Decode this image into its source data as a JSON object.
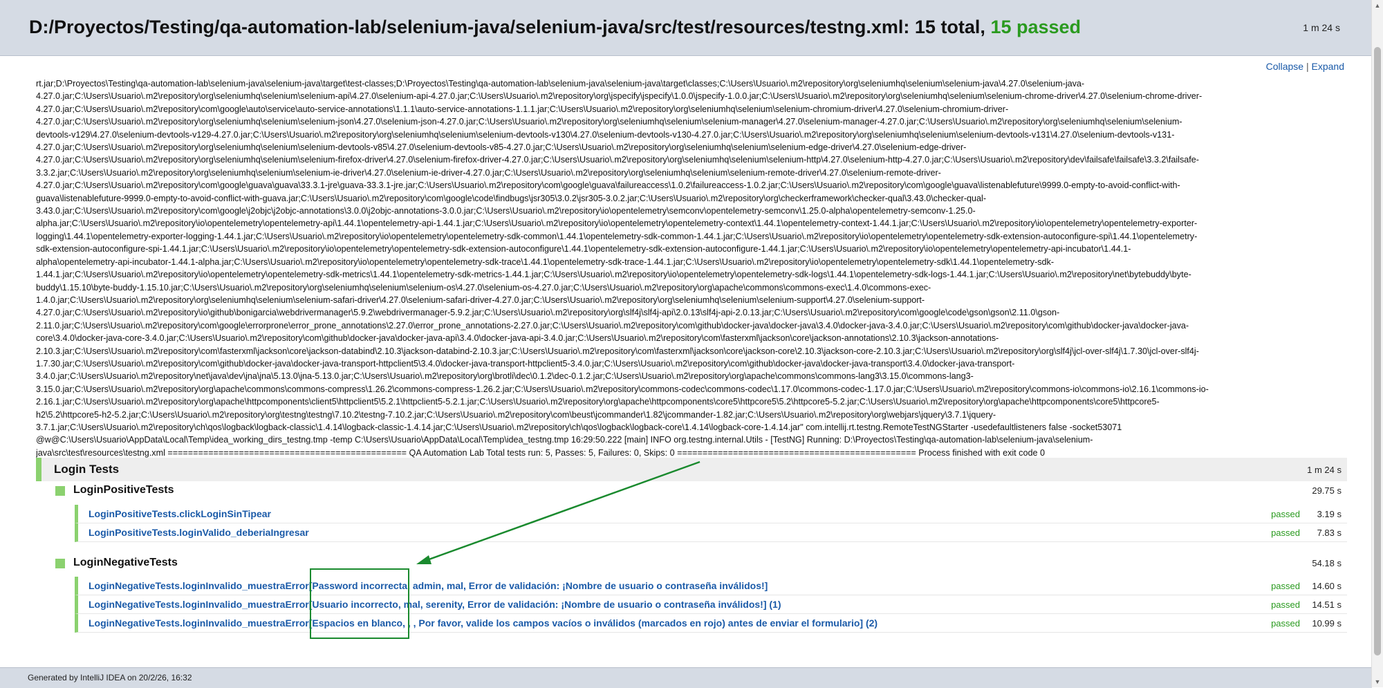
{
  "header": {
    "path": "D:/Proyectos/Testing/qa-automation-lab/selenium-java/selenium-java/src/test/resources/testng.xml:",
    "total": "15 total,",
    "passed": "15 passed",
    "time": "1 m 24 s"
  },
  "links": {
    "collapse": "Collapse",
    "separator": "|",
    "expand": "Expand"
  },
  "log_lines": [
    "rt.jar;D:\\Proyectos\\Testing\\qa-automation-lab\\selenium-java\\selenium-java\\target\\test-classes;D:\\Proyectos\\Testing\\qa-automation-lab\\selenium-java\\selenium-java\\target\\classes;C:\\Users\\Usuario\\.m2\\repository\\org\\seleniumhq\\selenium\\selenium-java\\4.27.0\\selenium-java-",
    "4.27.0.jar;C:\\Users\\Usuario\\.m2\\repository\\org\\seleniumhq\\selenium\\selenium-api\\4.27.0\\selenium-api-4.27.0.jar;C:\\Users\\Usuario\\.m2\\repository\\org\\jspecify\\jspecify\\1.0.0\\jspecify-1.0.0.jar;C:\\Users\\Usuario\\.m2\\repository\\org\\seleniumhq\\selenium\\selenium-chrome-driver\\4.27.0\\selenium-chrome-driver-",
    "4.27.0.jar;C:\\Users\\Usuario\\.m2\\repository\\com\\google\\auto\\service\\auto-service-annotations\\1.1.1\\auto-service-annotations-1.1.1.jar;C:\\Users\\Usuario\\.m2\\repository\\org\\seleniumhq\\selenium\\selenium-chromium-driver\\4.27.0\\selenium-chromium-driver-",
    "4.27.0.jar;C:\\Users\\Usuario\\.m2\\repository\\org\\seleniumhq\\selenium\\selenium-json\\4.27.0\\selenium-json-4.27.0.jar;C:\\Users\\Usuario\\.m2\\repository\\org\\seleniumhq\\selenium\\selenium-manager\\4.27.0\\selenium-manager-4.27.0.jar;C:\\Users\\Usuario\\.m2\\repository\\org\\seleniumhq\\selenium\\selenium-",
    "devtools-v129\\4.27.0\\selenium-devtools-v129-4.27.0.jar;C:\\Users\\Usuario\\.m2\\repository\\org\\seleniumhq\\selenium\\selenium-devtools-v130\\4.27.0\\selenium-devtools-v130-4.27.0.jar;C:\\Users\\Usuario\\.m2\\repository\\org\\seleniumhq\\selenium\\selenium-devtools-v131\\4.27.0\\selenium-devtools-v131-",
    "4.27.0.jar;C:\\Users\\Usuario\\.m2\\repository\\org\\seleniumhq\\selenium\\selenium-devtools-v85\\4.27.0\\selenium-devtools-v85-4.27.0.jar;C:\\Users\\Usuario\\.m2\\repository\\org\\seleniumhq\\selenium\\selenium-edge-driver\\4.27.0\\selenium-edge-driver-",
    "4.27.0.jar;C:\\Users\\Usuario\\.m2\\repository\\org\\seleniumhq\\selenium\\selenium-firefox-driver\\4.27.0\\selenium-firefox-driver-4.27.0.jar;C:\\Users\\Usuario\\.m2\\repository\\org\\seleniumhq\\selenium\\selenium-http\\4.27.0\\selenium-http-4.27.0.jar;C:\\Users\\Usuario\\.m2\\repository\\dev\\failsafe\\failsafe\\3.3.2\\failsafe-",
    "3.3.2.jar;C:\\Users\\Usuario\\.m2\\repository\\org\\seleniumhq\\selenium\\selenium-ie-driver\\4.27.0\\selenium-ie-driver-4.27.0.jar;C:\\Users\\Usuario\\.m2\\repository\\org\\seleniumhq\\selenium\\selenium-remote-driver\\4.27.0\\selenium-remote-driver-",
    "4.27.0.jar;C:\\Users\\Usuario\\.m2\\repository\\com\\google\\guava\\guava\\33.3.1-jre\\guava-33.3.1-jre.jar;C:\\Users\\Usuario\\.m2\\repository\\com\\google\\guava\\failureaccess\\1.0.2\\failureaccess-1.0.2.jar;C:\\Users\\Usuario\\.m2\\repository\\com\\google\\guava\\listenablefuture\\9999.0-empty-to-avoid-conflict-with-",
    "guava\\listenablefuture-9999.0-empty-to-avoid-conflict-with-guava.jar;C:\\Users\\Usuario\\.m2\\repository\\com\\google\\code\\findbugs\\jsr305\\3.0.2\\jsr305-3.0.2.jar;C:\\Users\\Usuario\\.m2\\repository\\org\\checkerframework\\checker-qual\\3.43.0\\checker-qual-",
    "3.43.0.jar;C:\\Users\\Usuario\\.m2\\repository\\com\\google\\j2objc\\j2objc-annotations\\3.0.0\\j2objc-annotations-3.0.0.jar;C:\\Users\\Usuario\\.m2\\repository\\io\\opentelemetry\\semconv\\opentelemetry-semconv\\1.25.0-alpha\\opentelemetry-semconv-1.25.0-",
    "alpha.jar;C:\\Users\\Usuario\\.m2\\repository\\io\\opentelemetry\\opentelemetry-api\\1.44.1\\opentelemetry-api-1.44.1.jar;C:\\Users\\Usuario\\.m2\\repository\\io\\opentelemetry\\opentelemetry-context\\1.44.1\\opentelemetry-context-1.44.1.jar;C:\\Users\\Usuario\\.m2\\repository\\io\\opentelemetry\\opentelemetry-exporter-",
    "logging\\1.44.1\\opentelemetry-exporter-logging-1.44.1.jar;C:\\Users\\Usuario\\.m2\\repository\\io\\opentelemetry\\opentelemetry-sdk-common\\1.44.1\\opentelemetry-sdk-common-1.44.1.jar;C:\\Users\\Usuario\\.m2\\repository\\io\\opentelemetry\\opentelemetry-sdk-extension-autoconfigure-spi\\1.44.1\\opentelemetry-",
    "sdk-extension-autoconfigure-spi-1.44.1.jar;C:\\Users\\Usuario\\.m2\\repository\\io\\opentelemetry\\opentelemetry-sdk-extension-autoconfigure\\1.44.1\\opentelemetry-sdk-extension-autoconfigure-1.44.1.jar;C:\\Users\\Usuario\\.m2\\repository\\io\\opentelemetry\\opentelemetry-api-incubator\\1.44.1-",
    "alpha\\opentelemetry-api-incubator-1.44.1-alpha.jar;C:\\Users\\Usuario\\.m2\\repository\\io\\opentelemetry\\opentelemetry-sdk-trace\\1.44.1\\opentelemetry-sdk-trace-1.44.1.jar;C:\\Users\\Usuario\\.m2\\repository\\io\\opentelemetry\\opentelemetry-sdk\\1.44.1\\opentelemetry-sdk-",
    "1.44.1.jar;C:\\Users\\Usuario\\.m2\\repository\\io\\opentelemetry\\opentelemetry-sdk-metrics\\1.44.1\\opentelemetry-sdk-metrics-1.44.1.jar;C:\\Users\\Usuario\\.m2\\repository\\io\\opentelemetry\\opentelemetry-sdk-logs\\1.44.1\\opentelemetry-sdk-logs-1.44.1.jar;C:\\Users\\Usuario\\.m2\\repository\\net\\bytebuddy\\byte-",
    "buddy\\1.15.10\\byte-buddy-1.15.10.jar;C:\\Users\\Usuario\\.m2\\repository\\org\\seleniumhq\\selenium\\selenium-os\\4.27.0\\selenium-os-4.27.0.jar;C:\\Users\\Usuario\\.m2\\repository\\org\\apache\\commons\\commons-exec\\1.4.0\\commons-exec-",
    "1.4.0.jar;C:\\Users\\Usuario\\.m2\\repository\\org\\seleniumhq\\selenium\\selenium-safari-driver\\4.27.0\\selenium-safari-driver-4.27.0.jar;C:\\Users\\Usuario\\.m2\\repository\\org\\seleniumhq\\selenium\\selenium-support\\4.27.0\\selenium-support-",
    "4.27.0.jar;C:\\Users\\Usuario\\.m2\\repository\\io\\github\\bonigarcia\\webdrivermanager\\5.9.2\\webdrivermanager-5.9.2.jar;C:\\Users\\Usuario\\.m2\\repository\\org\\slf4j\\slf4j-api\\2.0.13\\slf4j-api-2.0.13.jar;C:\\Users\\Usuario\\.m2\\repository\\com\\google\\code\\gson\\gson\\2.11.0\\gson-",
    "2.11.0.jar;C:\\Users\\Usuario\\.m2\\repository\\com\\google\\errorprone\\error_prone_annotations\\2.27.0\\error_prone_annotations-2.27.0.jar;C:\\Users\\Usuario\\.m2\\repository\\com\\github\\docker-java\\docker-java\\3.4.0\\docker-java-3.4.0.jar;C:\\Users\\Usuario\\.m2\\repository\\com\\github\\docker-java\\docker-java-",
    "core\\3.4.0\\docker-java-core-3.4.0.jar;C:\\Users\\Usuario\\.m2\\repository\\com\\github\\docker-java\\docker-java-api\\3.4.0\\docker-java-api-3.4.0.jar;C:\\Users\\Usuario\\.m2\\repository\\com\\fasterxml\\jackson\\core\\jackson-annotations\\2.10.3\\jackson-annotations-",
    "2.10.3.jar;C:\\Users\\Usuario\\.m2\\repository\\com\\fasterxml\\jackson\\core\\jackson-databind\\2.10.3\\jackson-databind-2.10.3.jar;C:\\Users\\Usuario\\.m2\\repository\\com\\fasterxml\\jackson\\core\\jackson-core\\2.10.3\\jackson-core-2.10.3.jar;C:\\Users\\Usuario\\.m2\\repository\\org\\slf4j\\jcl-over-slf4j\\1.7.30\\jcl-over-slf4j-",
    "1.7.30.jar;C:\\Users\\Usuario\\.m2\\repository\\com\\github\\docker-java\\docker-java-transport-httpclient5\\3.4.0\\docker-java-transport-httpclient5-3.4.0.jar;C:\\Users\\Usuario\\.m2\\repository\\com\\github\\docker-java\\docker-java-transport\\3.4.0\\docker-java-transport-",
    "3.4.0.jar;C:\\Users\\Usuario\\.m2\\repository\\net\\java\\dev\\jna\\jna\\5.13.0\\jna-5.13.0.jar;C:\\Users\\Usuario\\.m2\\repository\\org\\brotli\\dec\\0.1.2\\dec-0.1.2.jar;C:\\Users\\Usuario\\.m2\\repository\\org\\apache\\commons\\commons-lang3\\3.15.0\\commons-lang3-",
    "3.15.0.jar;C:\\Users\\Usuario\\.m2\\repository\\org\\apache\\commons\\commons-compress\\1.26.2\\commons-compress-1.26.2.jar;C:\\Users\\Usuario\\.m2\\repository\\commons-codec\\commons-codec\\1.17.0\\commons-codec-1.17.0.jar;C:\\Users\\Usuario\\.m2\\repository\\commons-io\\commons-io\\2.16.1\\commons-io-",
    "2.16.1.jar;C:\\Users\\Usuario\\.m2\\repository\\org\\apache\\httpcomponents\\client5\\httpclient5\\5.2.1\\httpclient5-5.2.1.jar;C:\\Users\\Usuario\\.m2\\repository\\org\\apache\\httpcomponents\\core5\\httpcore5\\5.2\\httpcore5-5.2.jar;C:\\Users\\Usuario\\.m2\\repository\\org\\apache\\httpcomponents\\core5\\httpcore5-",
    "h2\\5.2\\httpcore5-h2-5.2.jar;C:\\Users\\Usuario\\.m2\\repository\\org\\testng\\testng\\7.10.2\\testng-7.10.2.jar;C:\\Users\\Usuario\\.m2\\repository\\com\\beust\\jcommander\\1.82\\jcommander-1.82.jar;C:\\Users\\Usuario\\.m2\\repository\\org\\webjars\\jquery\\3.7.1\\jquery-",
    "3.7.1.jar;C:\\Users\\Usuario\\.m2\\repository\\ch\\qos\\logback\\logback-classic\\1.4.14\\logback-classic-1.4.14.jar;C:\\Users\\Usuario\\.m2\\repository\\ch\\qos\\logback\\logback-core\\1.4.14\\logback-core-1.4.14.jar\" com.intellij.rt.testng.RemoteTestNGStarter -usedefaultlisteners false -socket53071",
    "@w@C:\\Users\\Usuario\\AppData\\Local\\Temp\\idea_working_dirs_testng.tmp -temp C:\\Users\\Usuario\\AppData\\Local\\Temp\\idea_testng.tmp 16:29:50.222 [main] INFO org.testng.internal.Utils - [TestNG] Running: D:\\Proyectos\\Testing\\qa-automation-lab\\selenium-java\\selenium-",
    "java\\src\\test\\resources\\testng.xml =============================================== QA Automation Lab Total tests run: 5, Passes: 5, Failures: 0, Skips: 0 =============================================== Process finished with exit code 0"
  ],
  "suite": {
    "name": "Login Tests",
    "time": "1 m 24 s"
  },
  "groups": [
    {
      "name": "LoginPositiveTests",
      "time": "29.75 s",
      "tests": [
        {
          "name": "LoginPositiveTests.clickLoginSinTipear",
          "status": "passed",
          "time": "3.19 s"
        },
        {
          "name": "LoginPositiveTests.loginValido_deberiaIngresar",
          "status": "passed",
          "time": "7.83 s"
        }
      ]
    },
    {
      "name": "LoginNegativeTests",
      "time": "54.18 s",
      "tests": [
        {
          "name": "LoginNegativeTests.loginInvalido_muestraError[Password incorrecta, admin, mal, Error de validación: ¡Nombre de usuario o contraseña inválidos!]",
          "status": "passed",
          "time": "14.60 s"
        },
        {
          "name": "LoginNegativeTests.loginInvalido_muestraError[Usuario incorrecto, mal, serenity, Error de validación: ¡Nombre de usuario o contraseña inválidos!] (1)",
          "status": "passed",
          "time": "14.51 s"
        },
        {
          "name": "LoginNegativeTests.loginInvalido_muestraError[Espacios en blanco, , , Por favor, valide los campos vacíos o inválidos (marcados en rojo) antes de enviar el formulario] (2)",
          "status": "passed",
          "time": "10.99 s"
        }
      ]
    }
  ],
  "footer": {
    "text": "Generated by IntelliJ IDEA on 20/2/26, 16:32"
  },
  "colors": {
    "pass_green": "#2a9a1f",
    "link_blue": "#1a5aa8",
    "annotation_green": "#1a8a2e"
  }
}
